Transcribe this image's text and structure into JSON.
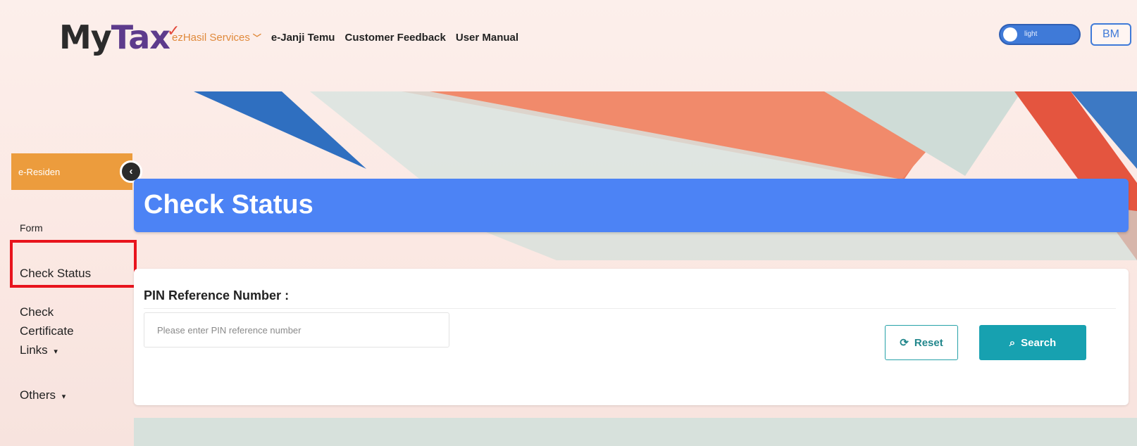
{
  "header": {
    "logo_my": "My",
    "logo_tax": "Tax",
    "nav": {
      "ezhasil": "ezHasil Services",
      "janji_temu": "e-Janji Temu",
      "feedback": "Customer Feedback",
      "manual": "User Manual"
    },
    "theme_toggle_label": "light",
    "language_button": "BM"
  },
  "sidebar": {
    "active_item": "e-Residen",
    "items": {
      "form": "Form",
      "check_status": "Check Status",
      "check_certificate": "Check Certificate",
      "links": "Links",
      "others": "Others"
    }
  },
  "main": {
    "title": "Check Status",
    "form": {
      "label": "PIN Reference Number :",
      "placeholder": "Please enter PIN reference number",
      "reset_label": "Reset",
      "search_label": "Search"
    }
  },
  "colors": {
    "title_bar": "#4c83f5",
    "sidebar_active": "#ec9c3d",
    "search_button": "#17a1b0",
    "highlight_box": "#e8141d"
  }
}
